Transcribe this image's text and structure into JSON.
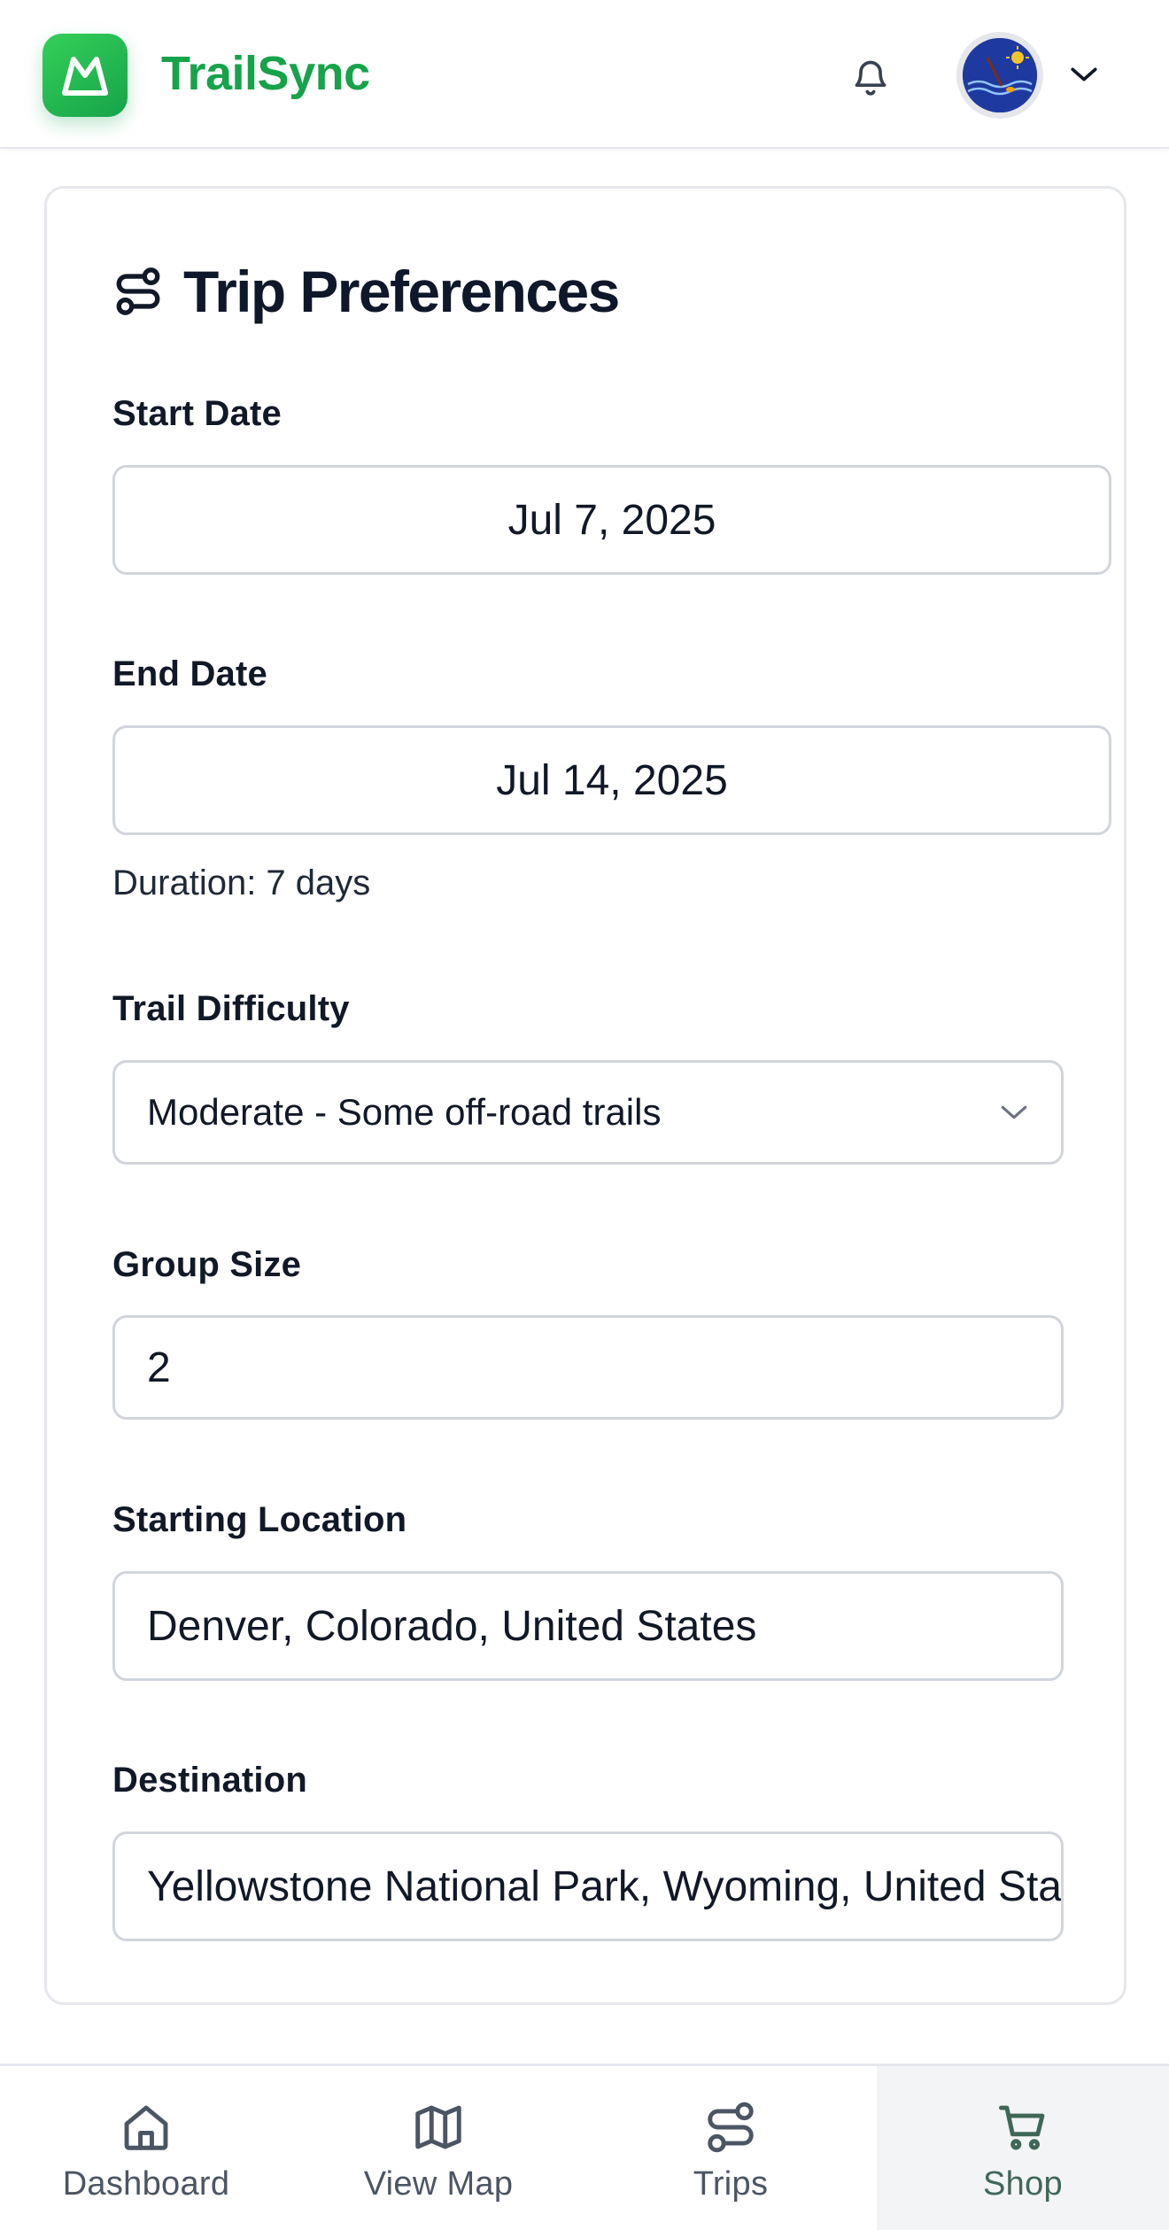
{
  "app": {
    "brand": "TrailSync",
    "accent_color": "#16a34a",
    "icons": {
      "logo": "mountain-logo-icon",
      "notifications": "bell-icon",
      "account_menu": "chevron-down-icon"
    }
  },
  "form": {
    "title": "Trip Preferences",
    "title_icon": "route-icon",
    "start_date": {
      "label": "Start Date",
      "value": "Jul 7, 2025"
    },
    "end_date": {
      "label": "End Date",
      "value": "Jul 14, 2025"
    },
    "duration_text": "Duration: 7 days",
    "difficulty": {
      "label": "Trail Difficulty",
      "value": "Moderate - Some off-road trails",
      "icon": "chevron-down-icon"
    },
    "group_size": {
      "label": "Group Size",
      "value": "2"
    },
    "starting_location": {
      "label": "Starting Location",
      "value": "Denver, Colorado, United States"
    },
    "destination": {
      "label": "Destination",
      "value": "Yellowstone National Park, Wyoming, United States"
    }
  },
  "bottom_nav": {
    "items": [
      {
        "label": "Dashboard",
        "icon": "home-icon"
      },
      {
        "label": "View Map",
        "icon": "map-icon"
      },
      {
        "label": "Trips",
        "icon": "route-icon"
      },
      {
        "label": "Shop",
        "icon": "cart-icon",
        "active": true
      }
    ],
    "active_bg": "#f3f4f6",
    "active_color": "#3f6757"
  }
}
